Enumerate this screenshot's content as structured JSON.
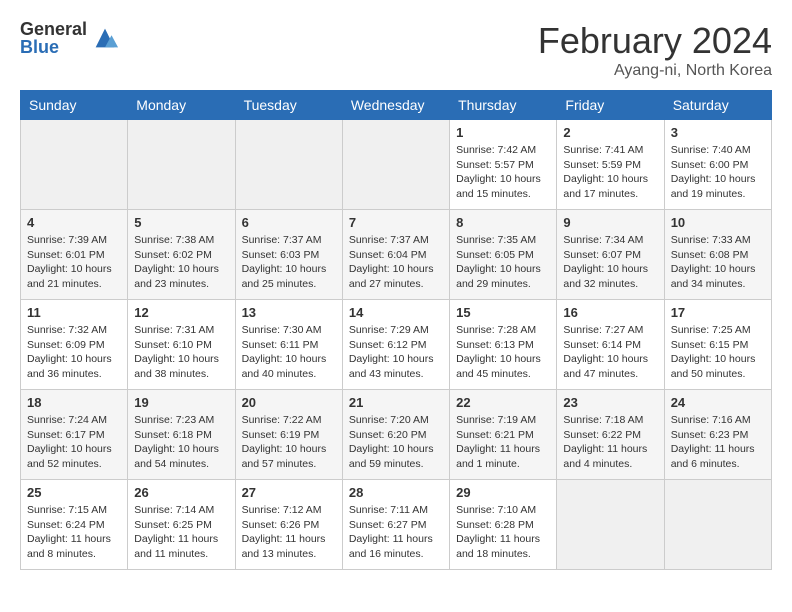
{
  "header": {
    "logo_general": "General",
    "logo_blue": "Blue",
    "title": "February 2024",
    "subtitle": "Ayang-ni, North Korea"
  },
  "days_of_week": [
    "Sunday",
    "Monday",
    "Tuesday",
    "Wednesday",
    "Thursday",
    "Friday",
    "Saturday"
  ],
  "weeks": [
    [
      {
        "day": "",
        "info": ""
      },
      {
        "day": "",
        "info": ""
      },
      {
        "day": "",
        "info": ""
      },
      {
        "day": "",
        "info": ""
      },
      {
        "day": "1",
        "info": "Sunrise: 7:42 AM\nSunset: 5:57 PM\nDaylight: 10 hours\nand 15 minutes."
      },
      {
        "day": "2",
        "info": "Sunrise: 7:41 AM\nSunset: 5:59 PM\nDaylight: 10 hours\nand 17 minutes."
      },
      {
        "day": "3",
        "info": "Sunrise: 7:40 AM\nSunset: 6:00 PM\nDaylight: 10 hours\nand 19 minutes."
      }
    ],
    [
      {
        "day": "4",
        "info": "Sunrise: 7:39 AM\nSunset: 6:01 PM\nDaylight: 10 hours\nand 21 minutes."
      },
      {
        "day": "5",
        "info": "Sunrise: 7:38 AM\nSunset: 6:02 PM\nDaylight: 10 hours\nand 23 minutes."
      },
      {
        "day": "6",
        "info": "Sunrise: 7:37 AM\nSunset: 6:03 PM\nDaylight: 10 hours\nand 25 minutes."
      },
      {
        "day": "7",
        "info": "Sunrise: 7:37 AM\nSunset: 6:04 PM\nDaylight: 10 hours\nand 27 minutes."
      },
      {
        "day": "8",
        "info": "Sunrise: 7:35 AM\nSunset: 6:05 PM\nDaylight: 10 hours\nand 29 minutes."
      },
      {
        "day": "9",
        "info": "Sunrise: 7:34 AM\nSunset: 6:07 PM\nDaylight: 10 hours\nand 32 minutes."
      },
      {
        "day": "10",
        "info": "Sunrise: 7:33 AM\nSunset: 6:08 PM\nDaylight: 10 hours\nand 34 minutes."
      }
    ],
    [
      {
        "day": "11",
        "info": "Sunrise: 7:32 AM\nSunset: 6:09 PM\nDaylight: 10 hours\nand 36 minutes."
      },
      {
        "day": "12",
        "info": "Sunrise: 7:31 AM\nSunset: 6:10 PM\nDaylight: 10 hours\nand 38 minutes."
      },
      {
        "day": "13",
        "info": "Sunrise: 7:30 AM\nSunset: 6:11 PM\nDaylight: 10 hours\nand 40 minutes."
      },
      {
        "day": "14",
        "info": "Sunrise: 7:29 AM\nSunset: 6:12 PM\nDaylight: 10 hours\nand 43 minutes."
      },
      {
        "day": "15",
        "info": "Sunrise: 7:28 AM\nSunset: 6:13 PM\nDaylight: 10 hours\nand 45 minutes."
      },
      {
        "day": "16",
        "info": "Sunrise: 7:27 AM\nSunset: 6:14 PM\nDaylight: 10 hours\nand 47 minutes."
      },
      {
        "day": "17",
        "info": "Sunrise: 7:25 AM\nSunset: 6:15 PM\nDaylight: 10 hours\nand 50 minutes."
      }
    ],
    [
      {
        "day": "18",
        "info": "Sunrise: 7:24 AM\nSunset: 6:17 PM\nDaylight: 10 hours\nand 52 minutes."
      },
      {
        "day": "19",
        "info": "Sunrise: 7:23 AM\nSunset: 6:18 PM\nDaylight: 10 hours\nand 54 minutes."
      },
      {
        "day": "20",
        "info": "Sunrise: 7:22 AM\nSunset: 6:19 PM\nDaylight: 10 hours\nand 57 minutes."
      },
      {
        "day": "21",
        "info": "Sunrise: 7:20 AM\nSunset: 6:20 PM\nDaylight: 10 hours\nand 59 minutes."
      },
      {
        "day": "22",
        "info": "Sunrise: 7:19 AM\nSunset: 6:21 PM\nDaylight: 11 hours\nand 1 minute."
      },
      {
        "day": "23",
        "info": "Sunrise: 7:18 AM\nSunset: 6:22 PM\nDaylight: 11 hours\nand 4 minutes."
      },
      {
        "day": "24",
        "info": "Sunrise: 7:16 AM\nSunset: 6:23 PM\nDaylight: 11 hours\nand 6 minutes."
      }
    ],
    [
      {
        "day": "25",
        "info": "Sunrise: 7:15 AM\nSunset: 6:24 PM\nDaylight: 11 hours\nand 8 minutes."
      },
      {
        "day": "26",
        "info": "Sunrise: 7:14 AM\nSunset: 6:25 PM\nDaylight: 11 hours\nand 11 minutes."
      },
      {
        "day": "27",
        "info": "Sunrise: 7:12 AM\nSunset: 6:26 PM\nDaylight: 11 hours\nand 13 minutes."
      },
      {
        "day": "28",
        "info": "Sunrise: 7:11 AM\nSunset: 6:27 PM\nDaylight: 11 hours\nand 16 minutes."
      },
      {
        "day": "29",
        "info": "Sunrise: 7:10 AM\nSunset: 6:28 PM\nDaylight: 11 hours\nand 18 minutes."
      },
      {
        "day": "",
        "info": ""
      },
      {
        "day": "",
        "info": ""
      }
    ]
  ]
}
